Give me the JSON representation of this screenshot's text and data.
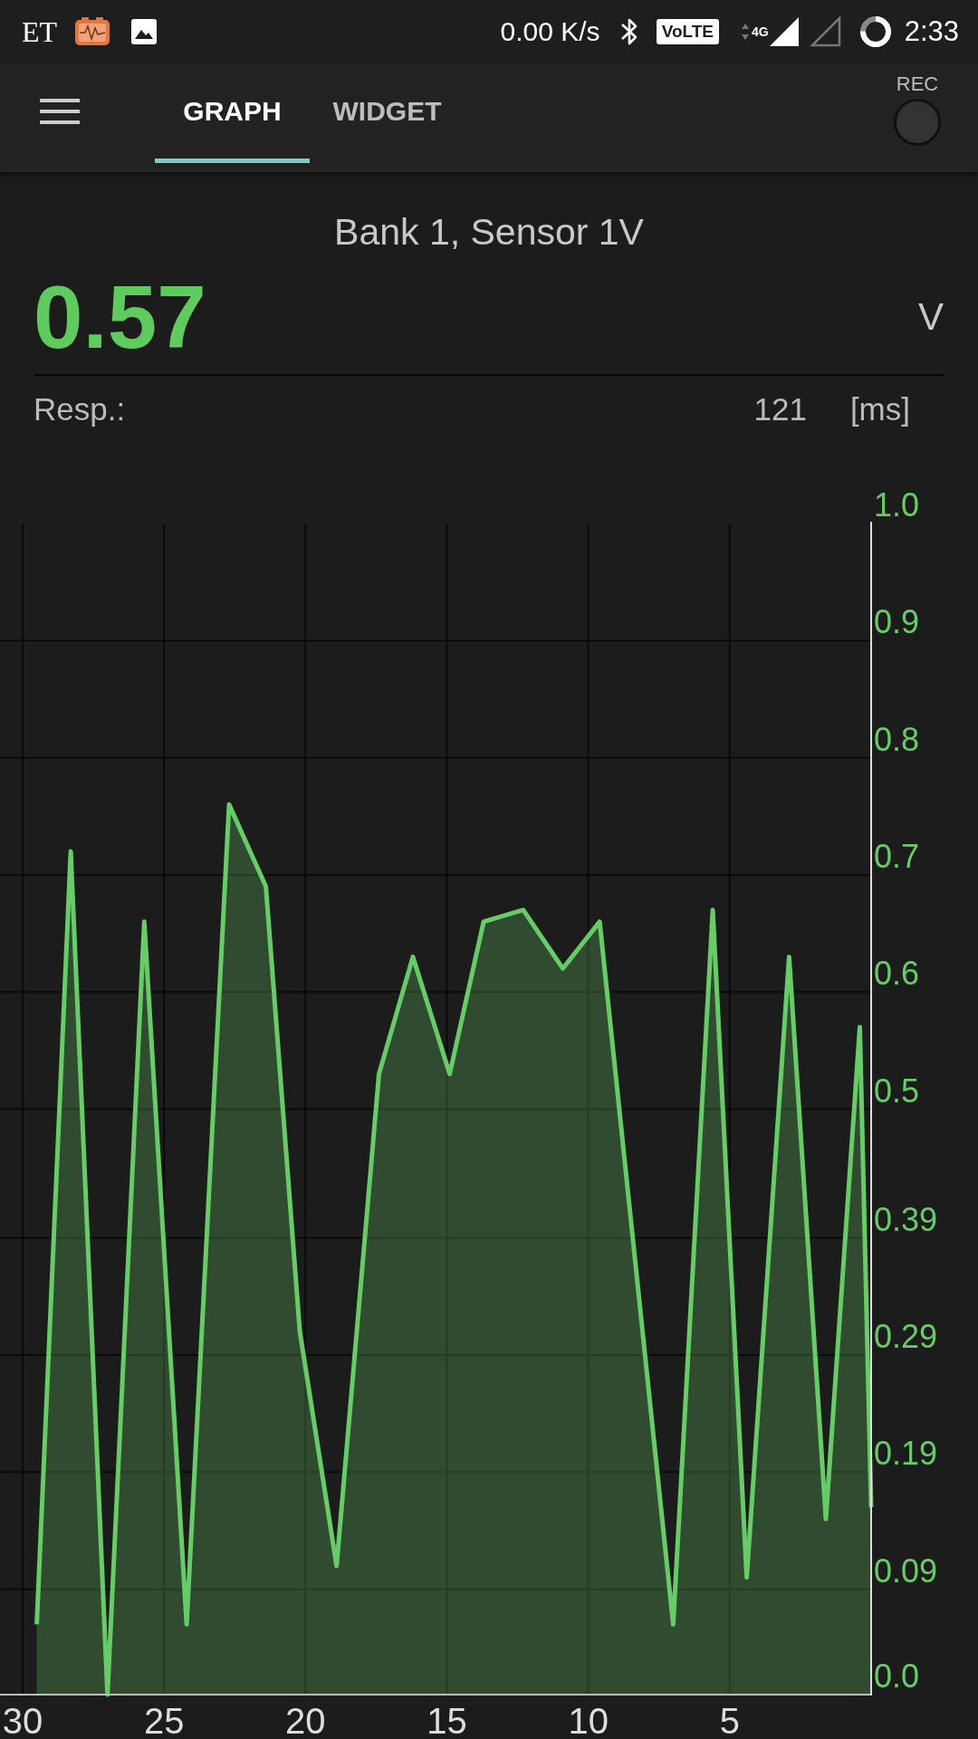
{
  "status_bar": {
    "app_label": "ET",
    "network_speed": "0.00 K/s",
    "volte_badge": "VoLTE",
    "network_type": "4G",
    "time": "2:33"
  },
  "app_bar": {
    "tabs": [
      {
        "label": "GRAPH",
        "selected": true
      },
      {
        "label": "WIDGET",
        "selected": false
      }
    ],
    "record": {
      "label": "REC",
      "recording": false
    }
  },
  "sensor": {
    "title": "Bank 1, Sensor 1V",
    "value": "0.57",
    "unit": "V",
    "response_label": "Resp.:",
    "response_value": "121",
    "response_unit": "[ms]"
  },
  "chart": {
    "chart_data": {
      "type": "area",
      "x": [
        29.5,
        28.3,
        27.0,
        25.7,
        24.2,
        22.7,
        21.4,
        20.2,
        18.9,
        17.4,
        16.2,
        14.9,
        13.7,
        12.3,
        10.9,
        9.6,
        7.0,
        5.6,
        4.4,
        2.9,
        1.6,
        0.4,
        0.0
      ],
      "series": [
        {
          "color": "#66cc66",
          "values": [
            0.06,
            0.72,
            0.0,
            0.66,
            0.06,
            0.76,
            0.69,
            0.31,
            0.11,
            0.53,
            0.63,
            0.53,
            0.66,
            0.67,
            0.62,
            0.66,
            0.06,
            0.67,
            0.1,
            0.63,
            0.15,
            0.57,
            0.16
          ]
        }
      ],
      "xlim": [
        30.8,
        0
      ],
      "ylim": [
        0,
        1
      ],
      "xticks": [
        30,
        25,
        20,
        15,
        10,
        5
      ],
      "yticks": [
        {
          "value": 0,
          "label": "0.0"
        },
        0.09,
        0.19,
        0.29,
        0.39,
        0.5,
        0.6,
        0.7,
        0.8,
        0.9,
        {
          "value": 1,
          "label": "1.0"
        }
      ],
      "grid": true
    }
  }
}
